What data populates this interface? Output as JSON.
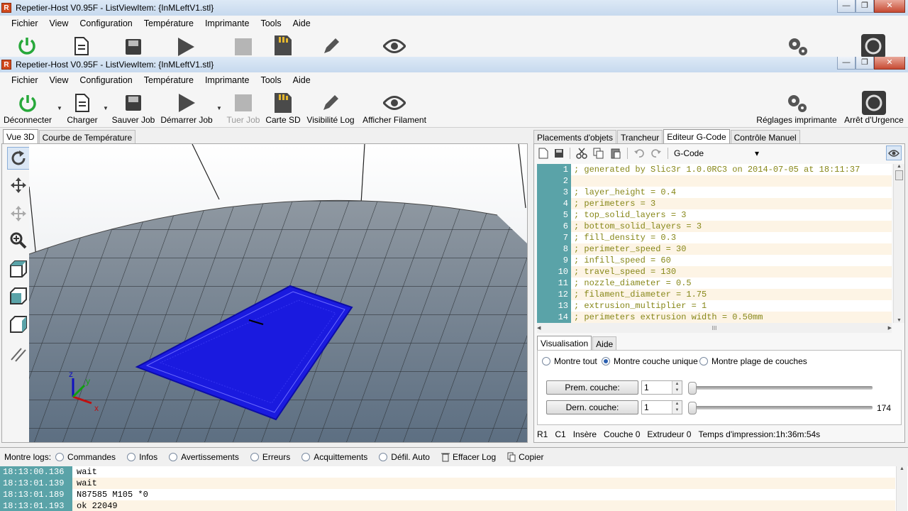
{
  "window_back": {
    "title": "Repetier-Host V0.95F - ListViewItem: {InMLeftV1.stl}"
  },
  "window_front": {
    "title": "Repetier-Host V0.95F - ListViewItem: {InMLeftV1.stl}"
  },
  "appicon": "R",
  "winbtns": {
    "minimize": "—",
    "maximize": "❐",
    "close": "✕"
  },
  "menu": [
    "Fichier",
    "View",
    "Configuration",
    "Température",
    "Imprimante",
    "Tools",
    "Aide"
  ],
  "toolbar": {
    "disconnect": "Déconnecter",
    "load": "Charger",
    "save_job": "Sauver Job",
    "start_job": "Démarrer Job",
    "kill_job": "Tuer Job",
    "sd_card": "Carte SD",
    "log_visibility": "Visibilité Log",
    "show_filament": "Afficher Filament",
    "printer_settings": "Réglages imprimante",
    "emergency_stop": "Arrêt d'Urgence"
  },
  "left_tabs": [
    "Vue 3D",
    "Courbe de Température"
  ],
  "right_tabs": [
    "Placements d'objets",
    "Trancheur",
    "Editeur G-Code",
    "Contrôle Manuel"
  ],
  "editor": {
    "mode": "G-Code",
    "dropdown_arrow": "▾"
  },
  "gcode_lines": [
    {
      "n": "1",
      "t": "; generated by Slic3r 1.0.0RC3 on 2014-07-05 at 18:11:37"
    },
    {
      "n": "2",
      "t": ""
    },
    {
      "n": "3",
      "t": "; layer_height = 0.4"
    },
    {
      "n": "4",
      "t": "; perimeters = 3"
    },
    {
      "n": "5",
      "t": "; top_solid_layers = 3"
    },
    {
      "n": "6",
      "t": "; bottom_solid_layers = 3"
    },
    {
      "n": "7",
      "t": "; fill_density = 0.3"
    },
    {
      "n": "8",
      "t": "; perimeter_speed = 30"
    },
    {
      "n": "9",
      "t": "; infill_speed = 60"
    },
    {
      "n": "10",
      "t": "; travel_speed = 130"
    },
    {
      "n": "11",
      "t": "; nozzle_diameter = 0.5"
    },
    {
      "n": "12",
      "t": "; filament_diameter = 1.75"
    },
    {
      "n": "13",
      "t": "; extrusion_multiplier = 1"
    },
    {
      "n": "14",
      "t": "; perimeters extrusion width = 0.50mm"
    }
  ],
  "scroll": {
    "left": "◀",
    "right": "▶",
    "up": "▲",
    "down": "▼",
    "grip": "III"
  },
  "vis_tabs": [
    "Visualisation",
    "Aide"
  ],
  "vis": {
    "show_all": "Montre tout",
    "single_layer": "Montre couche unique",
    "layer_range": "Montre plage de couches",
    "first_layer_btn": "Prem. couche:",
    "last_layer_btn": "Dern. couche:",
    "first_value": "1",
    "last_value": "1",
    "max_layer": "174",
    "spin_up": "▲",
    "spin_down": "▼"
  },
  "status": {
    "r": "R1",
    "c": "C1",
    "mode": "Insère",
    "layer": "Couche 0",
    "extruder": "Extrudeur 0",
    "print_time": "Temps d'impression:1h:36m:54s"
  },
  "logs": {
    "label": "Montre logs:",
    "options": [
      "Commandes",
      "Infos",
      "Avertissements",
      "Erreurs",
      "Acquittements",
      "Défil. Auto"
    ],
    "clear": "Effacer Log",
    "copy": "Copier",
    "lines": [
      {
        "time": "18:13:00.136",
        "text": "wait"
      },
      {
        "time": "18:13:01.139",
        "text": "wait"
      },
      {
        "time": "18:13:01.189",
        "text": "N87585 M105 *0"
      },
      {
        "time": "18:13:01.193",
        "text": "ok 22049"
      }
    ]
  },
  "axes": {
    "x": "x",
    "y": "y",
    "z": "z"
  },
  "colors": {
    "accent_teal": "#5aa3a8",
    "model_blue": "#1a1adf",
    "power_green": "#27a83a"
  }
}
